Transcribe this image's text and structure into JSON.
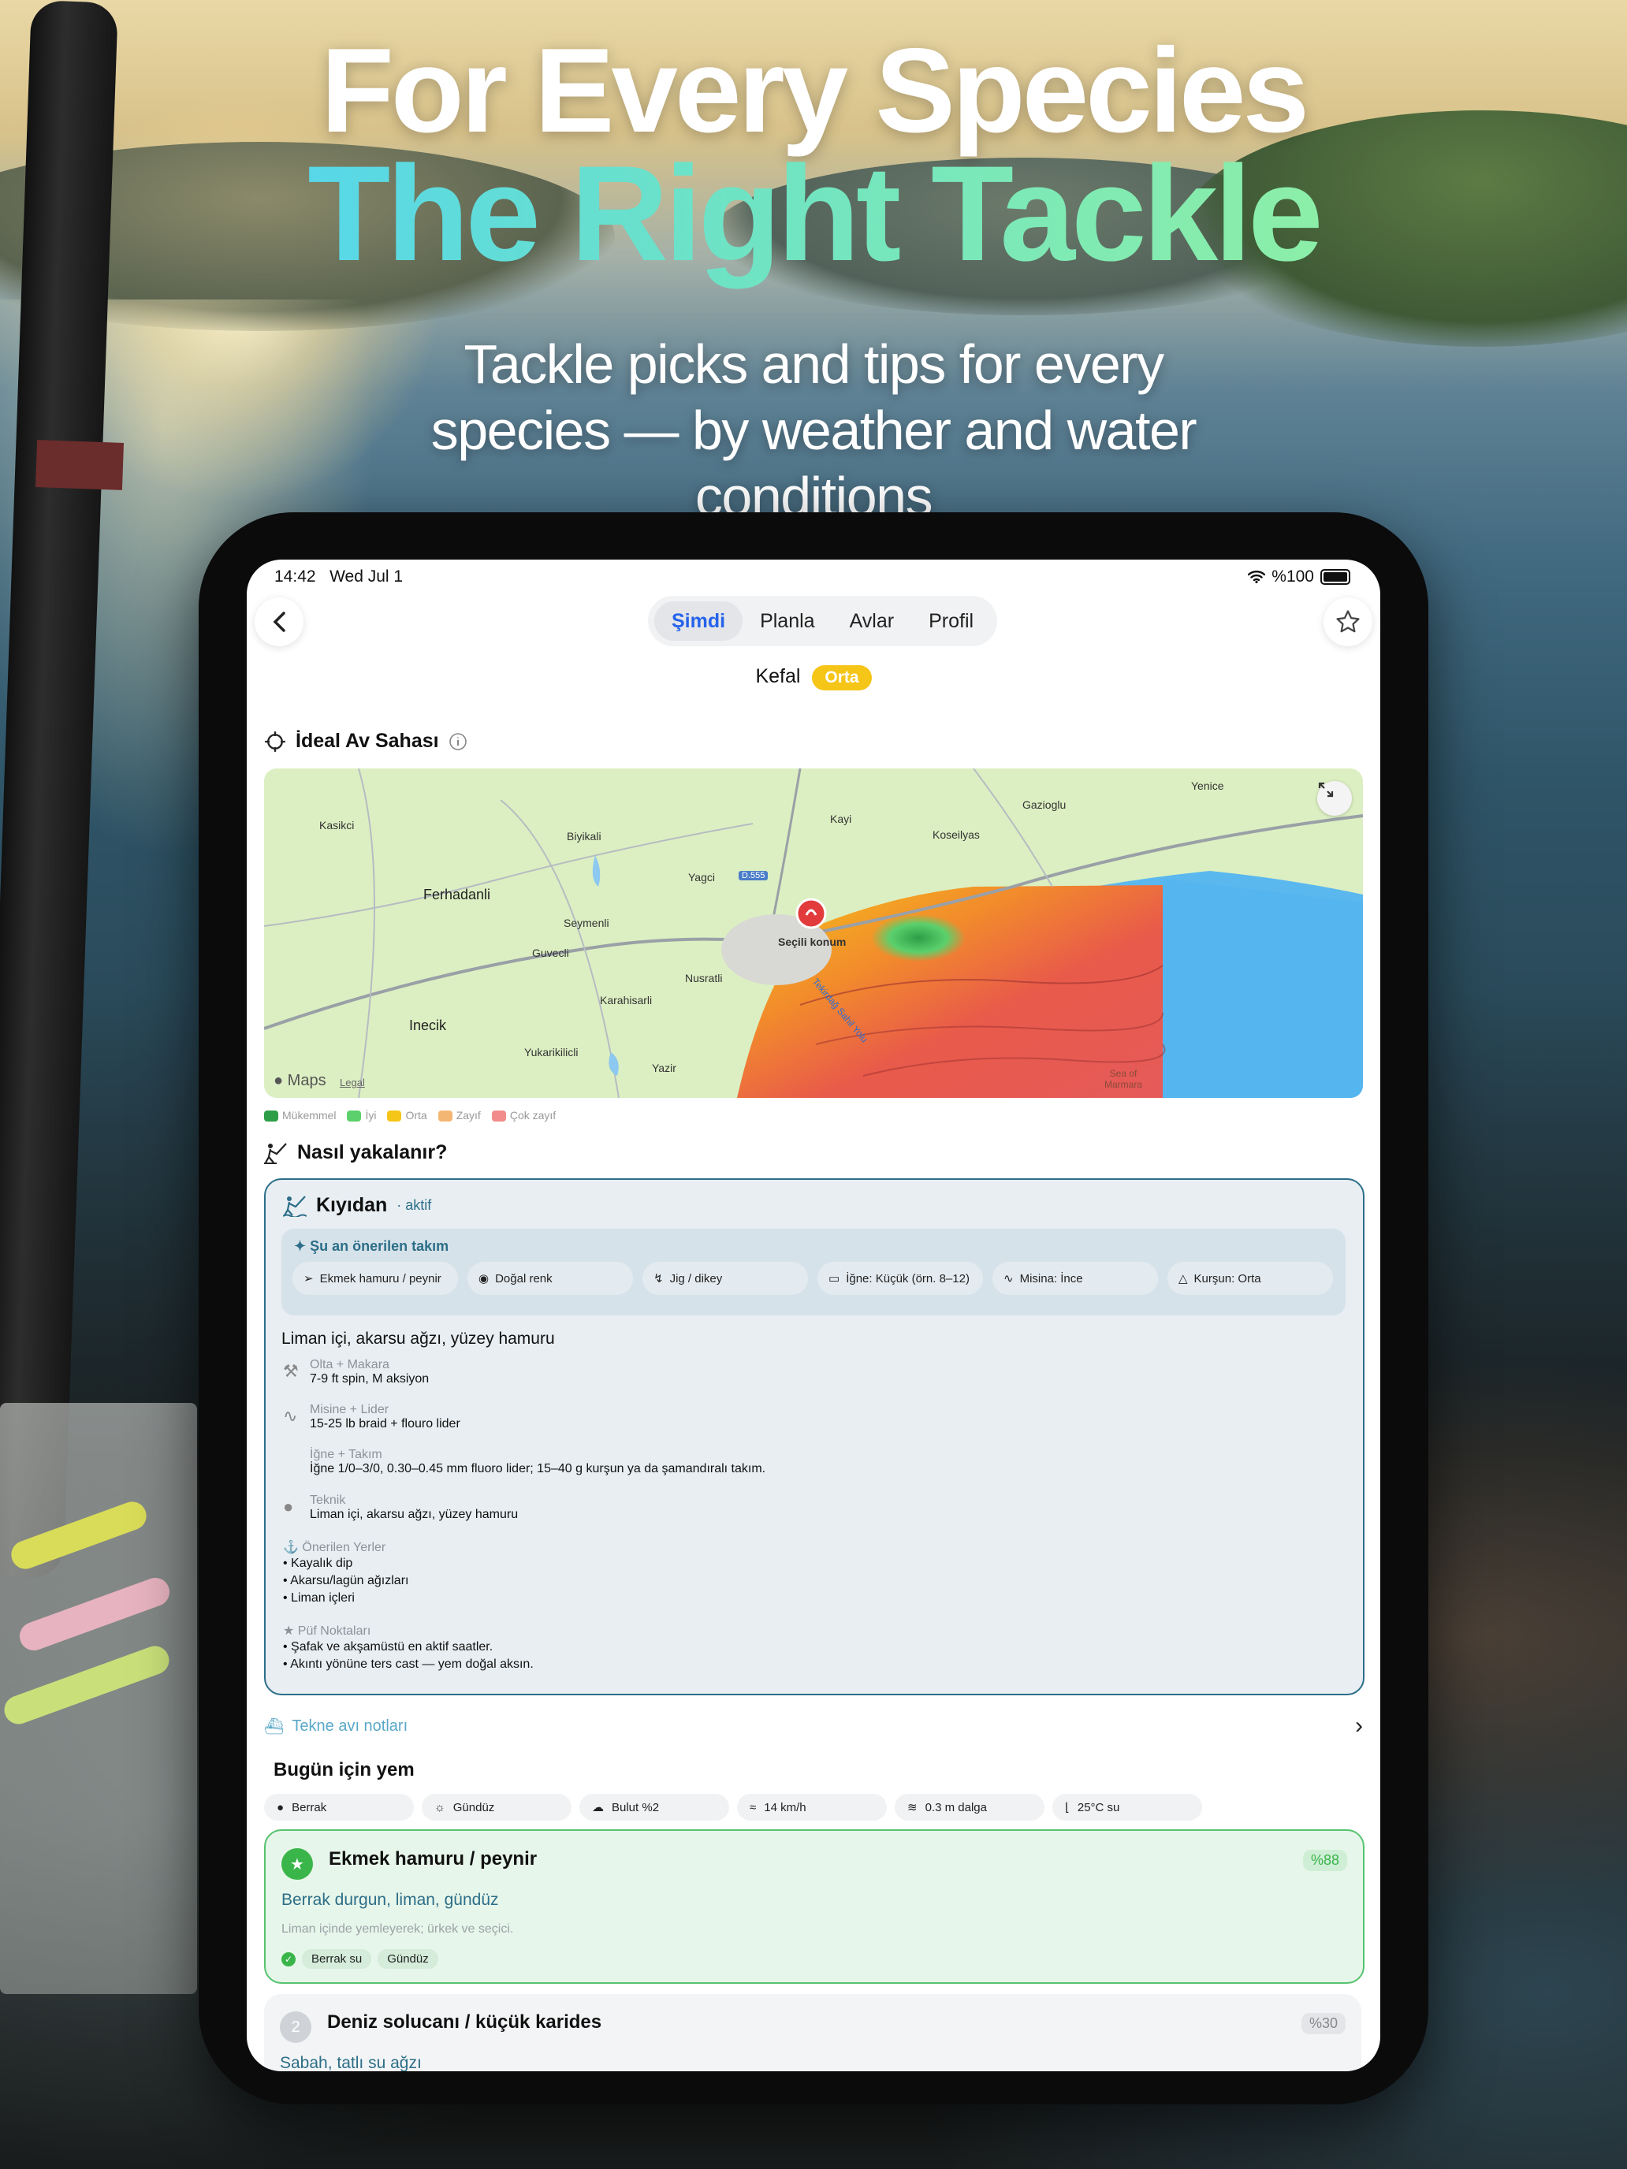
{
  "hero": {
    "line1": "For Every Species",
    "line2": "The Right Tackle",
    "subtitle": "Tackle picks and tips for every species — by weather and water conditions"
  },
  "status": {
    "time": "14:42",
    "date": "Wed Jul 1",
    "battery": "%100"
  },
  "tabs": [
    {
      "label": "Şimdi",
      "active": true
    },
    {
      "label": "Planla"
    },
    {
      "label": "Avlar"
    },
    {
      "label": "Profil"
    }
  ],
  "species": {
    "name": "Kefal",
    "rating": "Orta"
  },
  "ideal_area": {
    "title": "İdeal Av Sahası"
  },
  "map": {
    "places": [
      "Kasikci",
      "Biyikali",
      "Kayi",
      "Gazioglu",
      "Yenice",
      "Koseilyas",
      "Yagci",
      "D.555",
      "Ferhadanli",
      "Seymenli",
      "Guvecli",
      "Nusratli",
      "Karahisarli",
      "Inecik",
      "Yukarikilicli",
      "Yazir",
      "Seçili konum",
      "Sea of Marmara",
      "Tekirdağ Sahil Yolu"
    ],
    "maps_logo": "Maps",
    "legal": "Legal"
  },
  "legend": [
    {
      "label": "Mükemmel",
      "color": "#2e9e47"
    },
    {
      "label": "İyi",
      "color": "#5bd06c"
    },
    {
      "label": "Orta",
      "color": "#f5c518"
    },
    {
      "label": "Zayıf",
      "color": "#f4b673"
    },
    {
      "label": "Çok zayıf",
      "color": "#f28b8b"
    }
  ],
  "how": {
    "title": "Nasıl yakalanır?"
  },
  "method": {
    "title": "Kıyıdan",
    "status": "· aktif",
    "tackle_title": "Şu an önerilen takım",
    "pills": [
      {
        "icon": "fish-icon",
        "label": "Ekmek hamuru / peynir"
      },
      {
        "icon": "palette-icon",
        "label": "Doğal renk"
      },
      {
        "icon": "jig-icon",
        "label": "Jig / dikey"
      },
      {
        "icon": "hook-size-icon",
        "label": "İğne: Küçük (örn. 8–12)"
      },
      {
        "icon": "line-icon",
        "label": "Misina: İnce"
      },
      {
        "icon": "sinker-icon",
        "label": "Kurşun: Orta"
      }
    ],
    "headline": "Liman içi, akarsu ağzı, yüzey hamuru",
    "details": [
      {
        "label": "Olta + Makara",
        "value": "7-9 ft spin, M aksiyon"
      },
      {
        "label": "Misine + Lider",
        "value": "15-25 lb braid + flouro lider"
      },
      {
        "label": "İğne + Takım",
        "value": "İğne 1/0–3/0, 0.30–0.45 mm fluoro lider; 15–40 g kurşun ya da şamandıralı takım."
      },
      {
        "label": "Teknik",
        "value": "Liman içi, akarsu ağzı, yüzey hamuru"
      }
    ],
    "places_label": "Önerilen Yerler",
    "places": [
      "• Kayalık dip",
      "• Akarsu/lagün ağızları",
      "• Liman içleri"
    ],
    "tips_label": "Püf Noktaları",
    "tips": [
      "• Şafak ve akşamüstü en aktif saatler.",
      "• Akıntı yönüne ters cast — yem doğal aksın."
    ]
  },
  "boat": {
    "label": "Tekne avı notları"
  },
  "bait": {
    "title": "Bugün için yem",
    "conditions": [
      {
        "icon": "drop-icon",
        "label": "Berrak"
      },
      {
        "icon": "sun-icon",
        "label": "Gündüz"
      },
      {
        "icon": "cloud-icon",
        "label": "Bulut %2"
      },
      {
        "icon": "wind-icon",
        "label": "14 km/h"
      },
      {
        "icon": "wave-icon",
        "label": "0.3 m dalga"
      },
      {
        "icon": "thermometer-icon",
        "label": "25°C su"
      }
    ],
    "items": [
      {
        "rank": "★",
        "name": "Ekmek hamuru / peynir",
        "pct": "%88",
        "cond": "Berrak durgun, liman, gündüz",
        "desc": "Liman içinde yemleyerek; ürkek ve seçici.",
        "tags": [
          "Berrak su",
          "Gündüz"
        ]
      },
      {
        "rank": "2",
        "name": "Deniz solucanı / küçük karides",
        "pct": "%30",
        "cond": "Sabah, tatlı su ağzı"
      }
    ]
  }
}
